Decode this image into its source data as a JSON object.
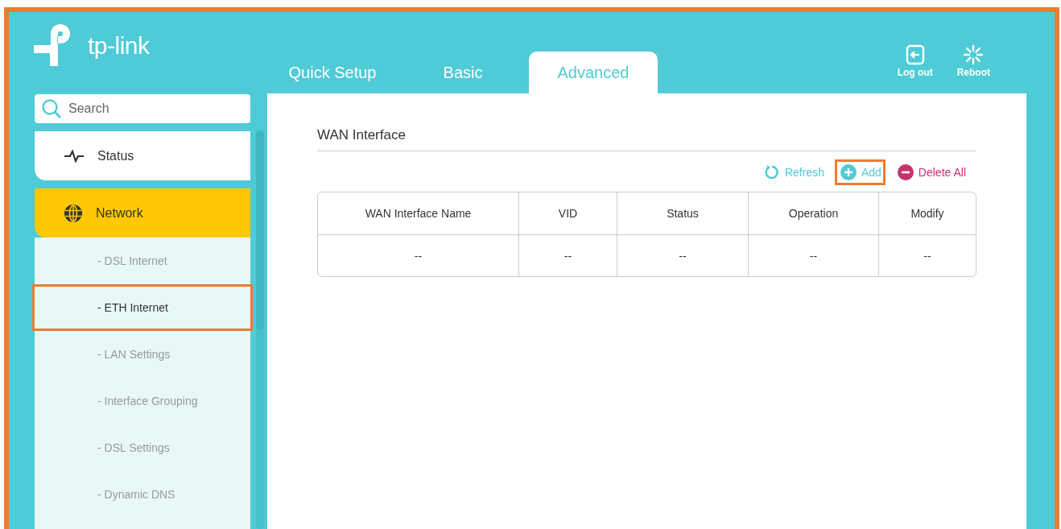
{
  "logo": {
    "text": "tp-link"
  },
  "tabs": [
    {
      "label": "Quick Setup",
      "selected": false
    },
    {
      "label": "Basic",
      "selected": false
    },
    {
      "label": "Advanced",
      "selected": true
    }
  ],
  "header_actions": [
    {
      "kind": "logout",
      "label": "Log out"
    },
    {
      "kind": "reboot",
      "label": "Reboot"
    }
  ],
  "search": {
    "placeholder": "Search"
  },
  "sidebar": {
    "items": [
      {
        "kind": "status",
        "label": "Status",
        "selected": false
      },
      {
        "kind": "network",
        "label": "Network",
        "selected": true
      }
    ],
    "sub_items": [
      {
        "label": "- DSL Internet",
        "selected": false,
        "highlighted": false
      },
      {
        "label": "- ETH Internet",
        "selected": true,
        "highlighted": true
      },
      {
        "label": "- LAN Settings",
        "selected": false,
        "highlighted": false
      },
      {
        "label": "- Interface Grouping",
        "selected": false,
        "highlighted": false
      },
      {
        "label": "- DSL Settings",
        "selected": false,
        "highlighted": false
      },
      {
        "label": "- Dynamic DNS",
        "selected": false,
        "highlighted": false
      }
    ]
  },
  "content": {
    "title": "WAN Interface",
    "actions": [
      {
        "kind": "refresh",
        "label": "Refresh",
        "highlighted": false
      },
      {
        "kind": "add",
        "label": "Add",
        "highlighted": true
      },
      {
        "kind": "delete",
        "label": "Delete All",
        "highlighted": false
      }
    ],
    "table": {
      "columns": [
        "WAN Interface Name",
        "VID",
        "Status",
        "Operation",
        "Modify"
      ],
      "rows": [
        [
          "--",
          "--",
          "--",
          "--",
          "--"
        ]
      ]
    }
  }
}
